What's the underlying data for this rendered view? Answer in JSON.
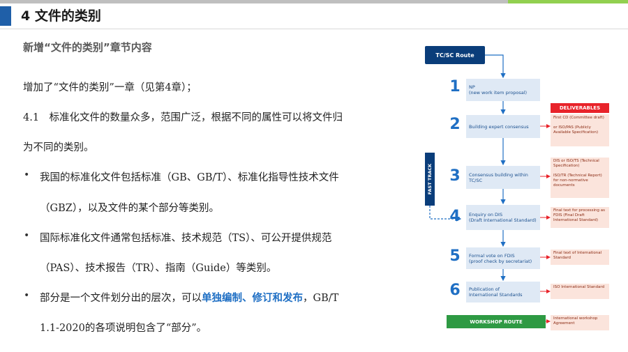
{
  "slide": {
    "title": "4 文件的类别",
    "subtitle": "新增“文件的类别”章节内容"
  },
  "body": {
    "line1": "增加了“文件的类别”一章（见第4章）；",
    "line2": "4.1　标准化文件的数量众多，范围广泛，根据不同的属性可以将文件归",
    "line3": "为不同的类别。",
    "bullets": [
      {
        "text_a": "我国的标准化文件包括标准（GB、GB/T）、标准化指导性技术文件",
        "text_b": "（GBZ），以及文件的某个部分等类别。"
      },
      {
        "text_a": "国际标准化文件通常包括标准、技术规范（TS）、可公开提供规范",
        "text_b": "（PAS）、技术报告（TR）、指南（Guide）等类别。"
      },
      {
        "text_a_pre": "部分是一个文件划分出的层次，可以",
        "text_a_hl": "单独编制、修订和发布",
        "text_a_post": "，GB/T",
        "text_b": "1.1-2020的各项说明包含了“部分”。"
      }
    ],
    "bullet_symbol": "•"
  },
  "flowchart": {
    "route_label": "TC/SC Route",
    "deliverables_header": "DELIVERABLES",
    "fast_track_label": "FAST TRACK",
    "workshop_route_label": "WORKSHOP ROUTE",
    "steps": [
      {
        "num": "1",
        "label": "NP\n(new work item proposal)"
      },
      {
        "num": "2",
        "label": "Building expert consensus"
      },
      {
        "num": "3",
        "label": "Consensus building within TC/SC"
      },
      {
        "num": "4",
        "label": "Enquiry on DIS\n(Draft International Standard)"
      },
      {
        "num": "5",
        "label": "Formal vote on FDIS\n(proof check by secretariat)"
      },
      {
        "num": "6",
        "label": "Publication of\nInternational Standards"
      }
    ],
    "deliverables": [
      "First CD (Committee draft)\n\nor ISO/PAS (Publicly Available Specification)",
      "DIS or ISO/TS (Technical Specification)\n\nISO/TR (Technical Report) for non-normative documents",
      "Final text for processing as FDIS (Final Draft International Standard)",
      "Final text of International Standard",
      "ISO International Standard",
      "International workshop Agreement"
    ]
  },
  "colors": {
    "accent_blue": "#1f5fa8",
    "highlight_blue": "#1f6fc4",
    "navy": "#0a3d7a",
    "deliverables_red": "#e8232a",
    "workshop_green": "#2e9a43",
    "top_bar_green": "#92d050"
  }
}
